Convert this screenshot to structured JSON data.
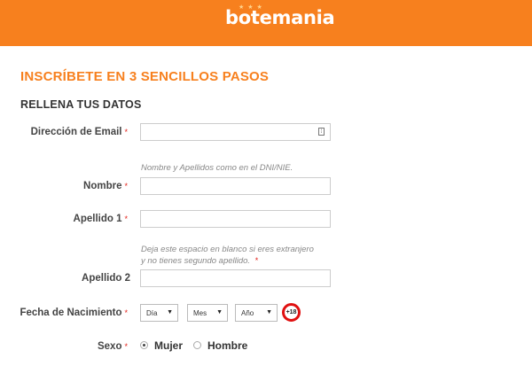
{
  "header": {
    "brand_color": "#f7801e",
    "logo_text": "botemania",
    "logo_stars": "★ ★ ★"
  },
  "main_title": "INSCRÍBETE EN 3 SENCILLOS PASOS",
  "section_title": "RELLENA TUS DATOS",
  "required_marker": "*",
  "fields": {
    "email": {
      "label": "Dirección de Email",
      "value": "",
      "icon": "input-helper-icon"
    },
    "name_hint": "Nombre y Apellidos como en el DNI/NIE.",
    "nombre": {
      "label": "Nombre",
      "value": ""
    },
    "apellido1": {
      "label": "Apellido 1",
      "value": ""
    },
    "apellido2_hint_line1": "Deja este espacio en blanco si eres extranjero",
    "apellido2_hint_line2": "y no tienes segundo apellido.",
    "apellido2": {
      "label": "Apellido 2",
      "value": ""
    },
    "birth": {
      "label": "Fecha de Nacimiento",
      "day": "Día",
      "month": "Mes",
      "year": "Año",
      "age_badge": "+18"
    },
    "sexo": {
      "label": "Sexo",
      "options": [
        "Mujer",
        "Hombre"
      ],
      "selected": "Mujer"
    }
  }
}
